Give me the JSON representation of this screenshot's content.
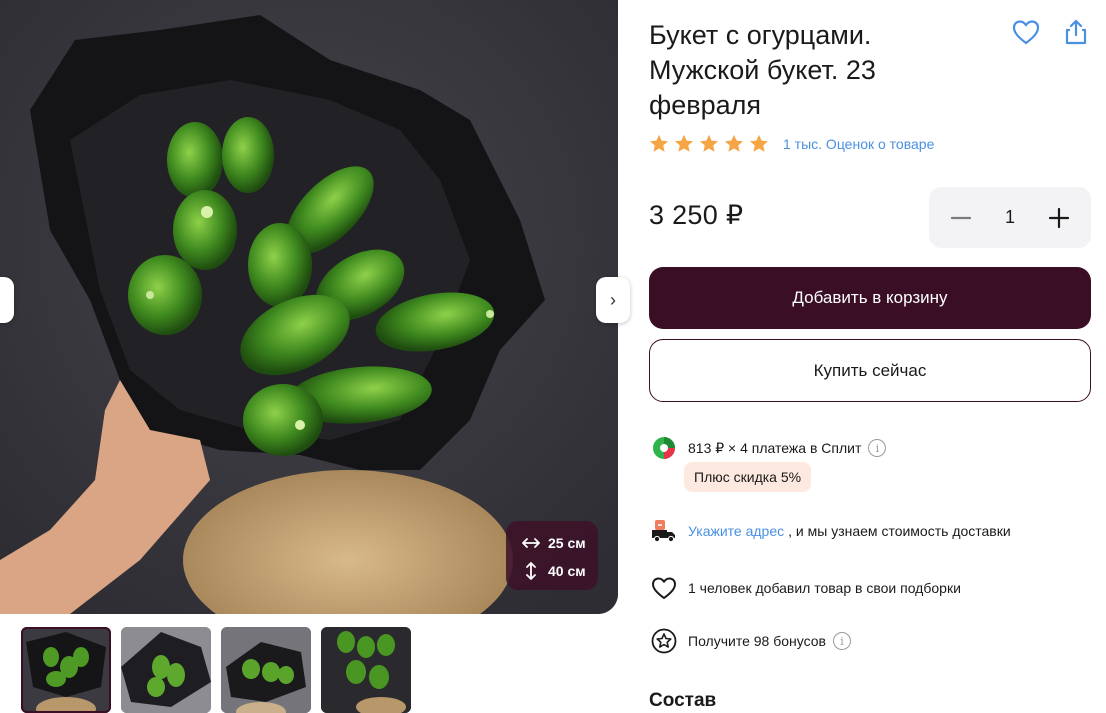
{
  "product": {
    "title_lines": [
      "Букет с огурцами.",
      "Мужской букет. 23",
      "февраля"
    ],
    "rating_stars": 5,
    "rating_text": "1 тыс. Оценок о товаре",
    "price": "3 250 ₽",
    "quantity": "1"
  },
  "gallery": {
    "size_width": "25 см",
    "size_height": "40 см",
    "thumb_count": 4,
    "active_thumb": 1
  },
  "actions": {
    "add_to_cart": "Добавить в корзину",
    "buy_now": "Купить сейчас"
  },
  "split": {
    "text": "813 ₽ × 4 платежа в Сплит",
    "discount": "Плюс скидка 5%"
  },
  "delivery": {
    "link": "Укажите адрес",
    "text": ", и мы узнаем стоимость доставки"
  },
  "favorites": {
    "text": "1 человек добавил товар в свои подборки"
  },
  "bonus": {
    "text": "Получите 98 бонусов"
  },
  "sections": {
    "composition": "Состав"
  },
  "icons": {
    "favorite": "heart-icon",
    "share": "share-icon",
    "star": "star-icon",
    "minus": "minus-icon",
    "plus": "plus-icon",
    "split": "split-logo-icon",
    "delivery": "delivery-truck-icon",
    "heart_outline": "heart-outline-icon",
    "bonus": "bonus-star-icon",
    "info": "info-icon",
    "width": "horizontal-arrows-icon",
    "height": "vertical-arrows-icon"
  },
  "colors": {
    "brand": "#3a0e25",
    "link": "#4a90e2",
    "star": "#f6a544",
    "discount_bg": "#fde9e0"
  }
}
